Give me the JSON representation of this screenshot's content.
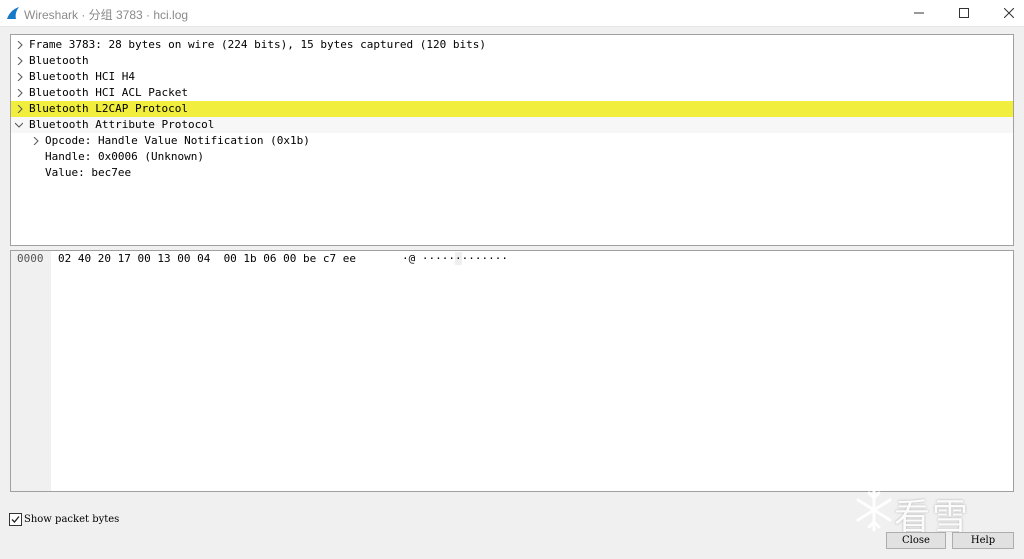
{
  "window": {
    "title": "Wireshark · 分组 3783 · hci.log",
    "minimize_glyph": "—",
    "maximize_glyph": "☐",
    "close_glyph": "✕"
  },
  "tree": [
    {
      "label": "Frame 3783: 28 bytes on wire (224 bits), 15 bytes captured (120 bits)",
      "state": "collapsed",
      "level": 0
    },
    {
      "label": "Bluetooth",
      "state": "collapsed",
      "level": 0
    },
    {
      "label": "Bluetooth HCI H4",
      "state": "collapsed",
      "level": 0
    },
    {
      "label": "Bluetooth HCI ACL Packet",
      "state": "collapsed",
      "level": 0
    },
    {
      "label": "Bluetooth L2CAP Protocol",
      "state": "collapsed",
      "level": 0,
      "selected": true
    },
    {
      "label": "Bluetooth Attribute Protocol",
      "state": "expanded",
      "level": 0
    },
    {
      "label": "Opcode: Handle Value Notification (0x1b)",
      "state": "collapsed",
      "level": 1
    },
    {
      "label": "Handle: 0x0006 (Unknown)",
      "state": "leaf",
      "level": 1
    },
    {
      "label": "Value: bec7ee",
      "state": "leaf",
      "level": 1
    }
  ],
  "bytes": {
    "offset": "0000",
    "hex": "02 40 20 17 00 13 00 04  00 1b 06 00 be c7 ee",
    "ascii_pre": "·@ ·····",
    "ascii_hl": "·",
    "ascii_post": "·······"
  },
  "footer": {
    "show_bytes_label": "Show packet bytes",
    "show_bytes_checked": true,
    "close_label": "Close",
    "help_label": "Help"
  },
  "watermark": {
    "text": "看雪"
  },
  "colors": {
    "selection": "#f2ee3e",
    "wireshark_fin": "#1679c8"
  }
}
